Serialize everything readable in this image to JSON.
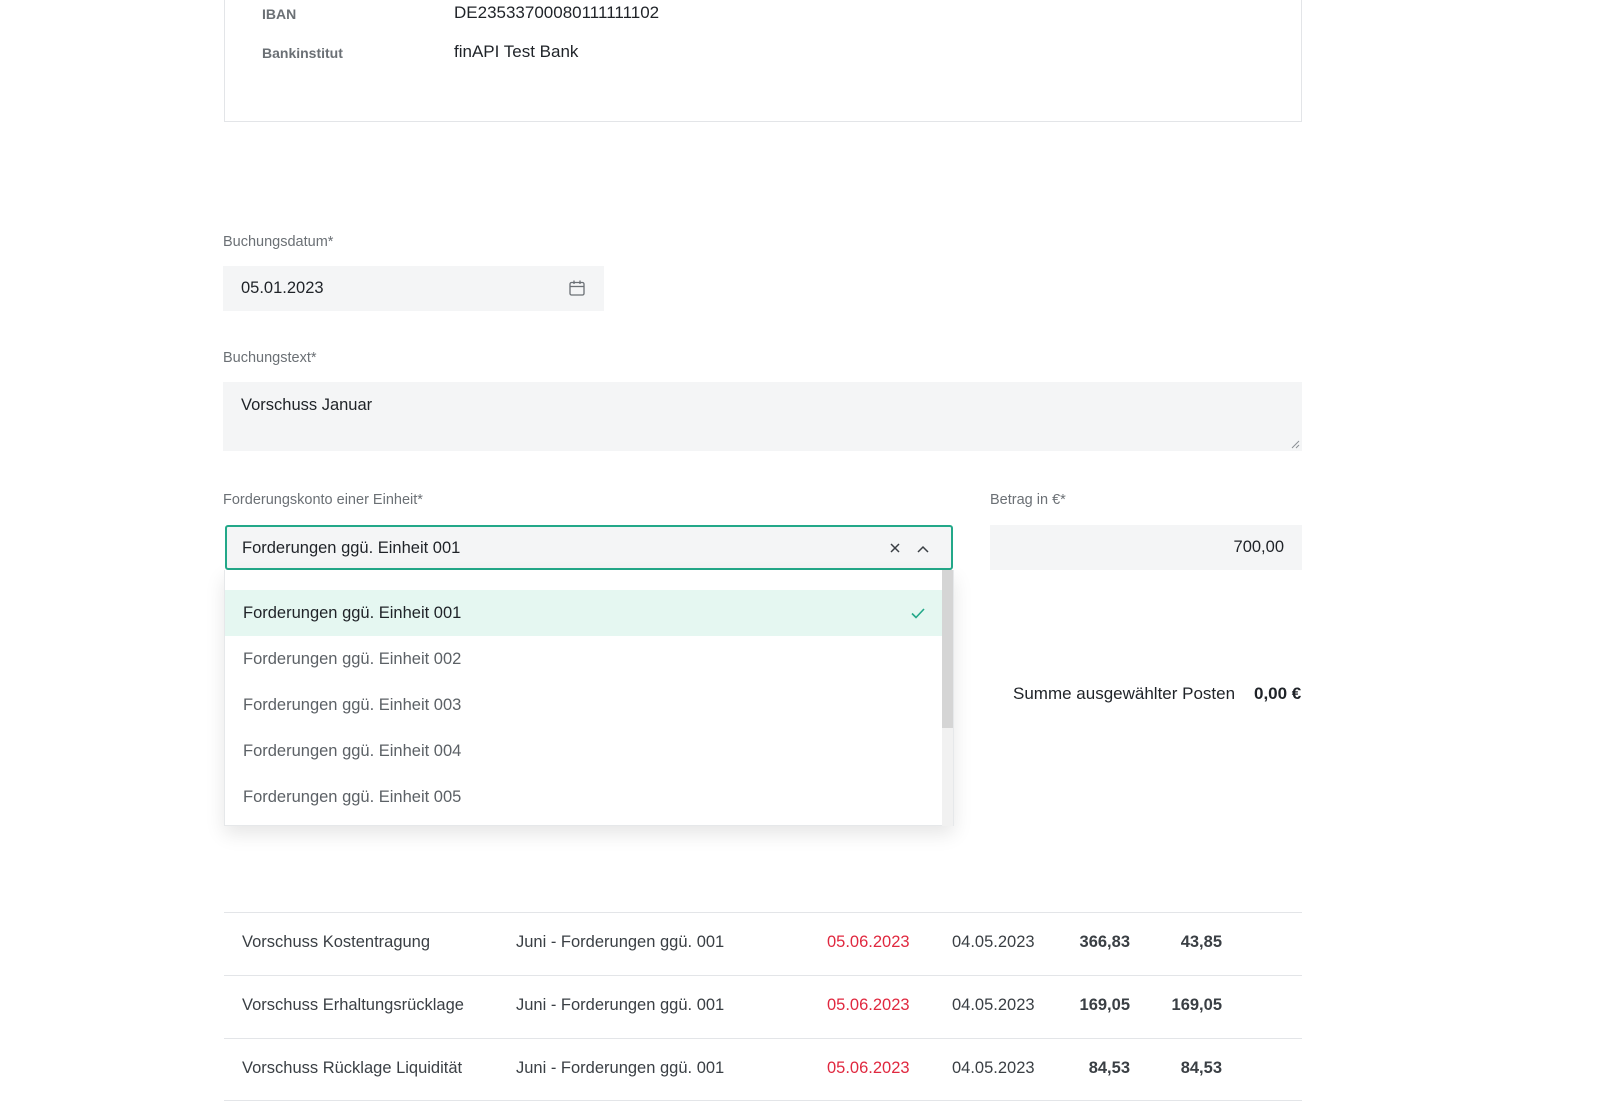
{
  "bank": {
    "iban_label": "IBAN",
    "iban_value": "DE23533700080111111102",
    "bank_label": "Bankinstitut",
    "bank_value": "finAPI Test Bank"
  },
  "form": {
    "booking_date_label": "Buchungsdatum*",
    "booking_date_value": "05.01.2023",
    "booking_text_label": "Buchungstext*",
    "booking_text_value": "Vorschuss Januar",
    "account_label": "Forderungskonto einer Einheit*",
    "account_selected": "Forderungen ggü. Einheit 001",
    "amount_label": "Betrag in €*",
    "amount_value": "700,00"
  },
  "dropdown": {
    "options": [
      {
        "label": "Forderungen ggü. Einheit 001",
        "selected": true
      },
      {
        "label": "Forderungen ggü. Einheit 002",
        "selected": false
      },
      {
        "label": "Forderungen ggü. Einheit 003",
        "selected": false
      },
      {
        "label": "Forderungen ggü. Einheit 004",
        "selected": false
      },
      {
        "label": "Forderungen ggü. Einheit 005",
        "selected": false
      }
    ],
    "scroll_position_fraction": 0.0
  },
  "summary": {
    "label": "Summe ausgewählter Posten",
    "value": "0,00 €"
  },
  "table": {
    "rows": [
      {
        "text": "Vorschuss Kostentragung",
        "account": "Juni - Forderungen ggü. 001",
        "due": "05.06.2023",
        "date": "04.05.2023",
        "amount": "366,83",
        "open": "43,85"
      },
      {
        "text": "Vorschuss Erhaltungsrücklage",
        "account": "Juni - Forderungen ggü. 001",
        "due": "05.06.2023",
        "date": "04.05.2023",
        "amount": "169,05",
        "open": "169,05"
      },
      {
        "text": "Vorschuss Rücklage Liquidität",
        "account": "Juni - Forderungen ggü. 001",
        "due": "05.06.2023",
        "date": "04.05.2023",
        "amount": "84,53",
        "open": "84,53"
      }
    ]
  },
  "colors": {
    "accent": "#23a889",
    "overdue": "#e0283f",
    "selected_option_bg": "#e5f7f1"
  },
  "icons": {
    "calendar": "calendar-icon",
    "clear": "close-icon",
    "collapse": "chevron-up-icon",
    "check": "check-icon"
  }
}
